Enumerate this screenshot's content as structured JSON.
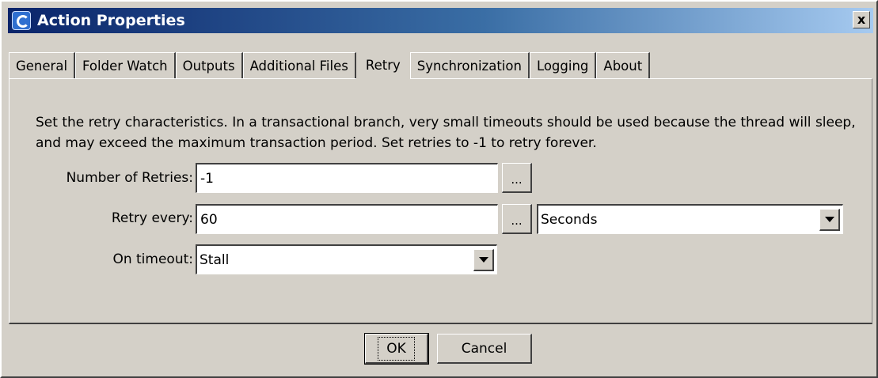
{
  "window": {
    "title": "Action Properties",
    "close_label": "x"
  },
  "tabs": [
    {
      "label": "General",
      "active": false
    },
    {
      "label": "Folder Watch",
      "active": false
    },
    {
      "label": "Outputs",
      "active": false
    },
    {
      "label": "Additional Files",
      "active": false
    },
    {
      "label": "Retry",
      "active": true
    },
    {
      "label": "Synchronization",
      "active": false
    },
    {
      "label": "Logging",
      "active": false
    },
    {
      "label": "About",
      "active": false
    }
  ],
  "retry": {
    "description": "Set the retry characteristics. In a transactional branch, very small timeouts should be used because the thread will sleep, and may exceed the maximum transaction period. Set retries to -1 to retry forever.",
    "num_retries_label": "Number of Retries:",
    "num_retries_value": "-1",
    "retry_every_label": "Retry every:",
    "retry_every_value": "60",
    "retry_unit_value": "Seconds",
    "on_timeout_label": "On timeout:",
    "on_timeout_value": "Stall",
    "ellipsis_label": "..."
  },
  "buttons": {
    "ok_label": "OK",
    "cancel_label": "Cancel"
  }
}
